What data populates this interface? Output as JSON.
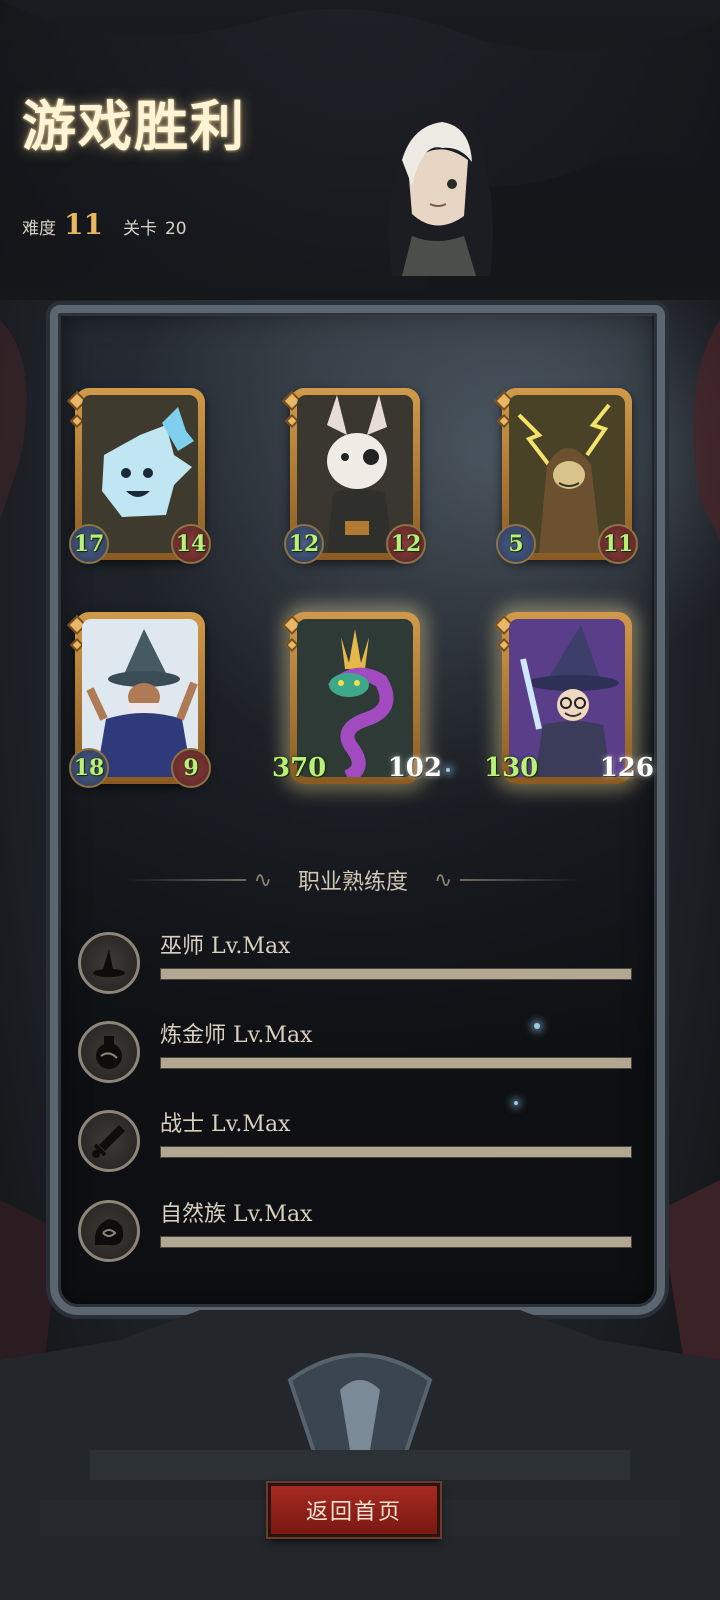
{
  "header": {
    "title": "游戏胜利",
    "difficulty_label": "难度",
    "difficulty_value": "11",
    "stage_label": "关卡",
    "stage_value": "20"
  },
  "cards": [
    {
      "name": "ice-crystal-creature",
      "attack": "17",
      "health": "14",
      "glow": false
    },
    {
      "name": "masked-rabbit-bandit",
      "attack": "12",
      "health": "12",
      "glow": false
    },
    {
      "name": "hooded-lightning-mage",
      "attack": "5",
      "health": "11",
      "glow": false
    },
    {
      "name": "bearded-wizard",
      "attack": "18",
      "health": "9",
      "glow": false
    },
    {
      "name": "crowned-serpent",
      "attack": "370",
      "health": "102",
      "glow": true
    },
    {
      "name": "glasses-witch",
      "attack": "130",
      "health": "126",
      "glow": true
    }
  ],
  "mastery": {
    "title": "职业熟练度",
    "items": [
      {
        "icon": "witch-hat-icon",
        "label": "巫师 Lv.Max",
        "progress": 1.0
      },
      {
        "icon": "potion-flask-icon",
        "label": "炼金师 Lv.Max",
        "progress": 1.0
      },
      {
        "icon": "sword-icon",
        "label": "战士 Lv.Max",
        "progress": 1.0
      },
      {
        "icon": "nature-spirit-icon",
        "label": "自然族 Lv.Max",
        "progress": 1.0
      }
    ]
  },
  "footer": {
    "home_button": "返回首页"
  },
  "colors": {
    "accent_gold": "#e8b860",
    "stat_green": "#b8f07a",
    "button_red": "#a52a22",
    "bar_fill": "#b2a791"
  }
}
